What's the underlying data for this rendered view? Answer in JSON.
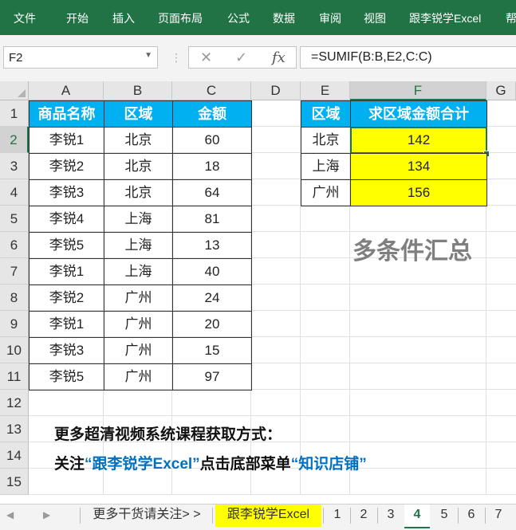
{
  "ribbon": {
    "tabs": [
      "文件",
      "开始",
      "插入",
      "页面布局",
      "公式",
      "数据",
      "审阅",
      "视图",
      "跟李锐学Excel",
      "帮"
    ]
  },
  "name_box": {
    "value": "F2"
  },
  "formula_bar": {
    "cancel_icon": "✕",
    "enter_icon": "✓",
    "fx_label": "fx",
    "formula": "=SUMIF(B:B,E2,C:C)"
  },
  "columns": [
    "A",
    "B",
    "C",
    "D",
    "E",
    "F",
    "G"
  ],
  "rows": [
    "1",
    "2",
    "3",
    "4",
    "5",
    "6",
    "7",
    "8",
    "9",
    "10",
    "11",
    "12",
    "13",
    "14",
    "15"
  ],
  "table1": {
    "headers": [
      "商品名称",
      "区域",
      "金额"
    ],
    "rows": [
      [
        "李锐1",
        "北京",
        "60"
      ],
      [
        "李锐2",
        "北京",
        "18"
      ],
      [
        "李锐3",
        "北京",
        "64"
      ],
      [
        "李锐4",
        "上海",
        "81"
      ],
      [
        "李锐5",
        "上海",
        "13"
      ],
      [
        "李锐1",
        "上海",
        "40"
      ],
      [
        "李锐2",
        "广州",
        "24"
      ],
      [
        "李锐1",
        "广州",
        "20"
      ],
      [
        "李锐3",
        "广州",
        "15"
      ],
      [
        "李锐5",
        "广州",
        "97"
      ]
    ]
  },
  "table2": {
    "headers": [
      "区域",
      "求区域金额合计"
    ],
    "rows": [
      [
        "北京",
        "142"
      ],
      [
        "上海",
        "134"
      ],
      [
        "广州",
        "156"
      ]
    ]
  },
  "title_text": "多条件汇总",
  "notes": {
    "line1": "更多超清视频系统课程获取方式：",
    "line2_a": "关注",
    "line2_b": "“跟李锐学Excel”",
    "line2_c": "点击底部菜单",
    "line2_d": "“知识店铺”"
  },
  "sheet_tabs": [
    "更多干货请关注> >",
    "跟李锐学Excel",
    "1",
    "2",
    "3",
    "4",
    "5",
    "6",
    "7"
  ],
  "colors": {
    "accent": "#217346",
    "header_fill": "#00b0f0",
    "result_fill": "#ffff00",
    "link_blue": "#0070c0"
  }
}
